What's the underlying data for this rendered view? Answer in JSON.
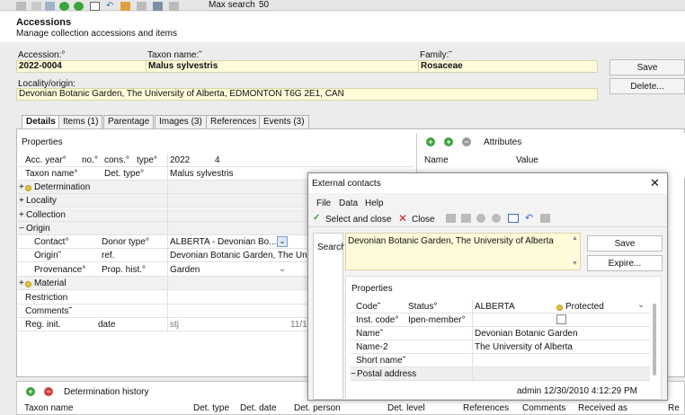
{
  "toolbar": {
    "max_search_label": "Max search",
    "max_search_value": "50"
  },
  "header": {
    "title": "Accessions",
    "subtitle": "Manage collection accessions and items"
  },
  "form": {
    "accession_label": "Accession:°",
    "accession_value": "2022-0004",
    "taxon_label": "Taxon name:˜",
    "taxon_value": "Malus sylvestris",
    "family_label": "Family:˜",
    "family_value": "Rosaceae",
    "locality_label": "Locality/origin:",
    "locality_value": "Devonian Botanic Garden, The University of Alberta, EDMONTON T6G 2E1, CAN"
  },
  "buttons": {
    "save": "Save",
    "delete": "Delete..."
  },
  "tabs": [
    "Details",
    "Items (1)",
    "Parentage",
    "Images (3)",
    "References",
    "Events (3)"
  ],
  "properties": {
    "title": "Properties",
    "acc_year": "Acc. year°",
    "no": "no.°",
    "cons": "cons.°",
    "type": "type°",
    "year_value": "2022",
    "no_value": "4",
    "taxon_name_label": "Taxon name°",
    "det_type_label": "Det. type°",
    "taxon_name_value": "Malus sylvestris",
    "determination": "Determination",
    "locality": "Locality",
    "collection": "Collection",
    "origin": "Origin",
    "contact": "Contact°",
    "donor_type": "Donor type°",
    "donor_value": "ALBERTA - Devonian Bo...",
    "origin_label": "Origin˜",
    "ref": "ref.",
    "origin_value": "Devonian Botanic Garden, The Univ...",
    "provenance": "Provenance°",
    "prop_hist": "Prop. hist.°",
    "prop_value": "Garden",
    "material": "Material",
    "restriction": "Restriction",
    "comments": "Comments˜",
    "reg_init": "Reg. init.",
    "date": "date",
    "reg_value": "stj",
    "date_value": "11/1"
  },
  "attributes": {
    "title": "Attributes",
    "col_name": "Name",
    "col_value": "Value"
  },
  "det_history": {
    "title": "Determination history",
    "columns": [
      "Taxon name",
      "Det. type",
      "Det. date",
      "Det. person",
      "Det. level",
      "References",
      "Comments",
      "Received as",
      "Re"
    ]
  },
  "dialog": {
    "title": "External contacts",
    "menu": [
      "File",
      "Data",
      "Help"
    ],
    "select_close": "Select and close",
    "close": "Close",
    "search_label": "Search",
    "contact_text": "Devonian Botanic Garden, The University of Alberta",
    "save": "Save",
    "expire": "Expire...",
    "properties_title": "Properties",
    "rows": {
      "code": "Code˜",
      "status": "Status°",
      "code_value": "ALBERTA",
      "status_value": "Protected",
      "inst_code": "Inst. code°",
      "ipen": "Ipen-member°",
      "name": "Name˜",
      "name_value": "Devonian Botanic Garden",
      "name2": "Name-2",
      "name2_value": "The University of Alberta",
      "short_name": "Short name˜",
      "postal": "Postal address"
    },
    "footer": "admin 12/30/2010 4:12:29 PM"
  },
  "colors": {
    "yellow_field": "#fdfbd8",
    "green_icon": "#3aa33a",
    "red_icon": "#d04040"
  }
}
